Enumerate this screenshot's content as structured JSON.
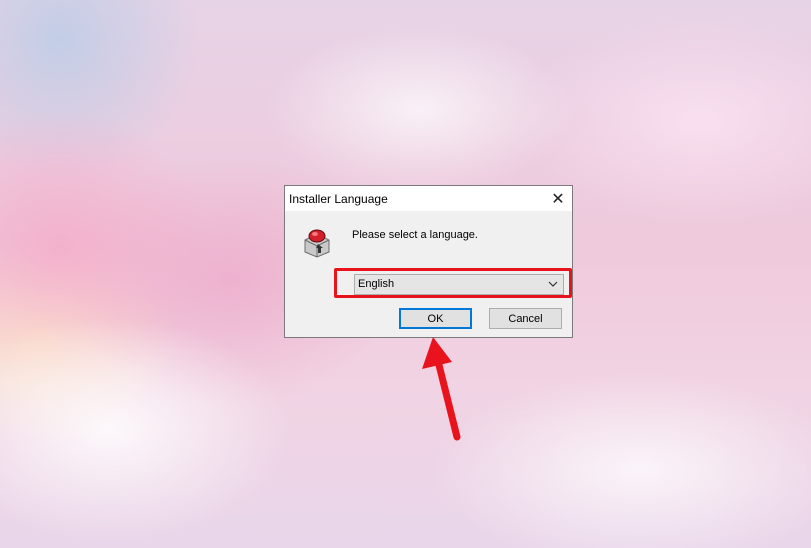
{
  "dialog": {
    "title": "Installer Language",
    "close_symbol": "✕",
    "icon": "installer-box-icon",
    "prompt": "Please select a language.",
    "language_select": {
      "selected": "English"
    },
    "ok_label": "OK",
    "cancel_label": "Cancel"
  },
  "annotations": {
    "highlight_color": "#e8131c",
    "arrow_color": "#e8131c",
    "arrow_target": "ok-button"
  }
}
